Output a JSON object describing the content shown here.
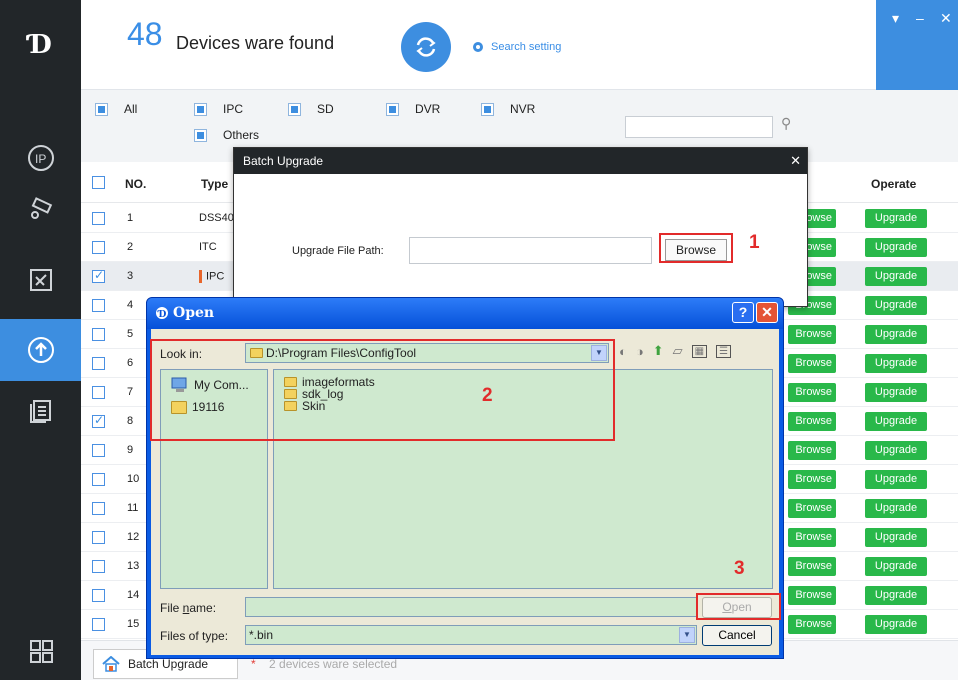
{
  "header": {
    "count": "48",
    "found_label": "Devices ware found",
    "search_setting": "Search setting"
  },
  "filters": {
    "all": "All",
    "ipc": "IPC",
    "sd": "SD",
    "dvr": "DVR",
    "nvr": "NVR",
    "others": "Others",
    "search_value": ""
  },
  "table": {
    "headers": {
      "no": "NO.",
      "type": "Type",
      "operate": "Operate"
    },
    "browse_label": "Browse",
    "upgrade_label": "Upgrade",
    "rows": [
      {
        "no": "1",
        "type": "DSS40",
        "checked": false
      },
      {
        "no": "2",
        "type": "ITC",
        "checked": false
      },
      {
        "no": "3",
        "type": "IPC",
        "checked": true
      },
      {
        "no": "4",
        "type": "",
        "checked": false
      },
      {
        "no": "5",
        "type": "",
        "checked": false
      },
      {
        "no": "6",
        "type": "",
        "checked": false
      },
      {
        "no": "7",
        "type": "",
        "checked": false
      },
      {
        "no": "8",
        "type": "",
        "checked": true
      },
      {
        "no": "9",
        "type": "",
        "checked": false
      },
      {
        "no": "10",
        "type": "",
        "checked": false
      },
      {
        "no": "11",
        "type": "",
        "checked": false
      },
      {
        "no": "12",
        "type": "",
        "checked": false
      },
      {
        "no": "13",
        "type": "",
        "checked": false
      },
      {
        "no": "14",
        "type": "",
        "checked": false
      },
      {
        "no": "15",
        "type": "",
        "checked": false
      }
    ]
  },
  "footer": {
    "batch_upgrade": "Batch Upgrade",
    "selected_info": "2   devices ware selected"
  },
  "batch_dialog": {
    "title": "Batch Upgrade",
    "path_label": "Upgrade File Path:",
    "path_value": "",
    "browse": "Browse",
    "annotation_1": "1"
  },
  "open_dialog": {
    "title": "Open",
    "look_in_label": "Look in:",
    "look_in_value": "D:\\Program Files\\ConfigTool",
    "places": [
      "My Com...",
      "19116"
    ],
    "files": [
      "imageformats",
      "sdk_log",
      "Skin"
    ],
    "file_name_label_pre": "File ",
    "file_name_label_acc": "n",
    "file_name_label_post": "ame:",
    "file_name_value": "",
    "files_of_type_label": "Files of type:",
    "files_of_type_value": "*.bin",
    "open_pre": "",
    "open_acc": "O",
    "open_post": "pen",
    "cancel": "Cancel",
    "annotation_2": "2",
    "annotation_3": "3"
  },
  "colors": {
    "accent": "#3d8ee0",
    "sidebar": "#222629",
    "button_green": "#29b84a",
    "annotation_red": "#e22b2b",
    "xp_blue": "#0a5be4"
  }
}
